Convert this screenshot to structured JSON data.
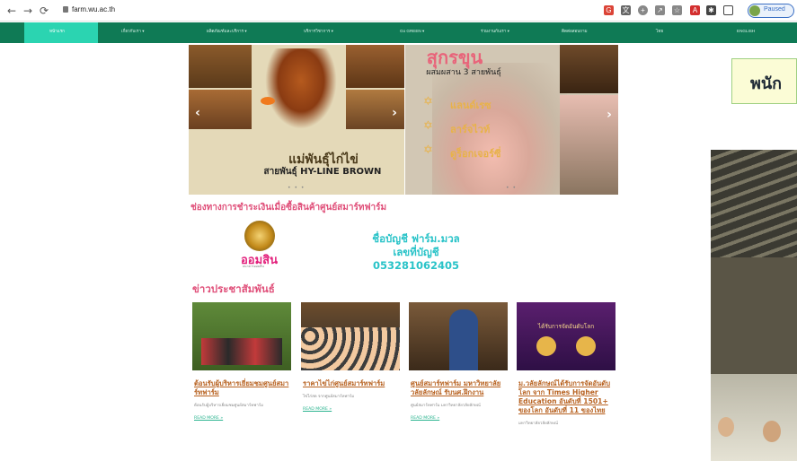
{
  "browser": {
    "url": "farm.wu.ac.th",
    "profile_status": "Paused",
    "back_icon": "back-arrow-icon",
    "forward_icon": "forward-arrow-icon",
    "reload_icon": "reload-icon"
  },
  "menu": {
    "items": [
      "หน้าแรก",
      "เกี่ยวกับเรา ▾",
      "ผลิตภัณฑ์และบริการ ▾",
      "บริการวิชาการ ▾",
      "Go GREEN ▾",
      "ร่วมงานกับเรา ▾",
      "ติดต่อสอบถาม",
      "ไทย",
      "ENGLISH"
    ]
  },
  "slide_left": {
    "title": "แม่พันธุ์ไก่ไข่",
    "subtitle": "สายพันธุ์ HY-LINE BROWN"
  },
  "slide_right": {
    "title": "สุกรขุน",
    "subtitle": "ผสมผสาน 3 สายพันธุ์",
    "breeds": [
      "แลนด์เรซ",
      "ลาร์จไวท์",
      "ดูร็อกเจอร์ซี่"
    ]
  },
  "payment": {
    "heading": "ช่องทางการชำระเงินเมื่อซื้อสินค้าศูนย์สมาร์ทฟาร์ม",
    "bank_name": "ออมสิน",
    "bank_small": "ธนาคารออมสิน",
    "account_name": "ชื่อบัญชี ฟาร์ม.มวล",
    "account_no": "เลขที่บัญชี 053281062405"
  },
  "news": {
    "heading": "ข่าวประชาสัมพันธ์",
    "read_more": "READ MORE »",
    "cards": [
      {
        "title": "ต้อนรับผู้บริหารเยี่ยมชมศูนย์สมาร์ทฟาร์ม",
        "desc": "ต้อนรับผู้บริหารเยี่ยมชมศูนย์สมาร์ทฟาร์ม"
      },
      {
        "title": "ราคาไข่ไก่ศูนย์สมาร์ทฟาร์ม",
        "desc": "ไข่ไก่สด จากศูนย์สมาร์ทฟาร์ม"
      },
      {
        "title": "ศูนย์สมาร์ทฟาร์ม มหาวิทยาลัยวลัยลักษณ์ รับนศ.ฝึกงาน",
        "desc": "ศูนย์สมาร์ทฟาร์ม มหาวิทยาลัยวลัยลักษณ์"
      },
      {
        "title": "ม.วลัยลักษณ์ได้รับการจัดอันดับโลก จาก Times Higher Education อันดับที่ 1501+ ของโลก อันดับที่ 11 ของไทย",
        "desc": "มหาวิทยาลัยวลัยลักษณ์",
        "banner": "ได้รับการจัดอันดับโลก"
      }
    ]
  },
  "side": {
    "heading": "พนัก"
  }
}
